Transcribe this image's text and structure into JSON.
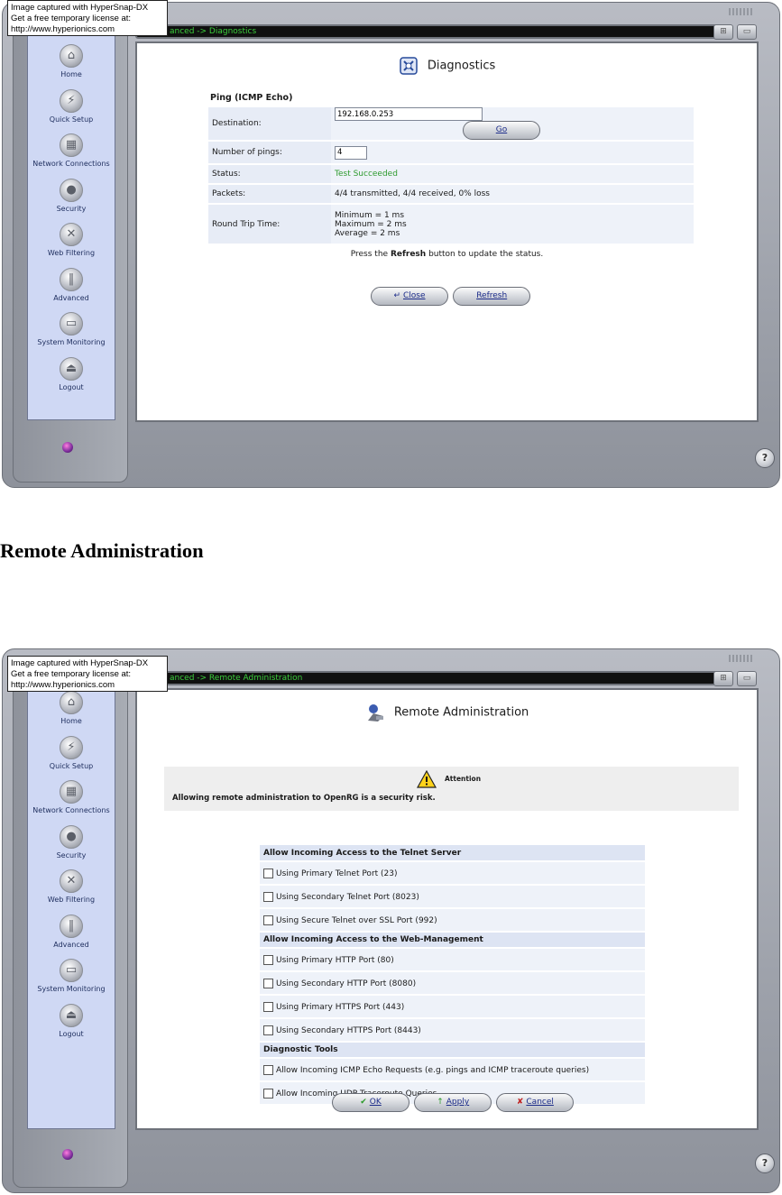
{
  "watermark": {
    "line1": "Image captured with HyperSnap-DX",
    "line2": "Get a free temporary license at:",
    "line3": "http://www.hyperionics.com"
  },
  "sidebar": {
    "items": [
      {
        "label": "Home",
        "icon": "home-icon"
      },
      {
        "label": "Quick Setup",
        "icon": "lightning-icon"
      },
      {
        "label": "Network Connections",
        "icon": "network-icon"
      },
      {
        "label": "Security",
        "icon": "lock-icon"
      },
      {
        "label": "Web Filtering",
        "icon": "filter-icon"
      },
      {
        "label": "Advanced",
        "icon": "tools-icon"
      },
      {
        "label": "System Monitoring",
        "icon": "monitor-icon"
      },
      {
        "label": "Logout",
        "icon": "logout-icon"
      }
    ]
  },
  "diagnostics": {
    "breadcrumb": "anced -> Diagnostics",
    "title": "Diagnostics",
    "section": "Ping (ICMP Echo)",
    "destination_label": "Destination:",
    "destination_value": "192.168.0.253",
    "go_label": "Go",
    "pings_label": "Number of pings:",
    "pings_value": "4",
    "status_label": "Status:",
    "status_value": "Test Succeeded",
    "packets_label": "Packets:",
    "packets_value": "4/4 transmitted, 4/4 received, 0% loss",
    "rtt_label": "Round Trip Time:",
    "rtt_min": "Minimum = 1 ms",
    "rtt_max": "Maximum = 2 ms",
    "rtt_avg": "Average = 2 ms",
    "note_pre": "Press the ",
    "note_bold": "Refresh",
    "note_post": " button to update the status.",
    "close_label": "Close",
    "refresh_label": "Refresh"
  },
  "heading": "Remote Administration",
  "remote": {
    "breadcrumb": "anced -> Remote Administration",
    "title": "Remote Administration",
    "attention_label": "Attention",
    "attention_text": "Allowing remote administration to OpenRG is a security risk.",
    "telnet_header": "Allow Incoming Access to the Telnet Server",
    "telnet_opts": [
      "Using Primary Telnet Port (23)",
      "Using Secondary Telnet Port (8023)",
      "Using Secure Telnet over SSL Port (992)"
    ],
    "web_header": "Allow Incoming Access to the Web-Management",
    "web_opts": [
      "Using Primary HTTP Port (80)",
      "Using Secondary HTTP Port (8080)",
      "Using Primary HTTPS Port (443)",
      "Using Secondary HTTPS Port (8443)"
    ],
    "diag_header": "Diagnostic Tools",
    "diag_opts": [
      "Allow Incoming ICMP Echo Requests (e.g. pings and ICMP traceroute queries)",
      "Allow Incoming UDP Traceroute Queries"
    ],
    "ok_label": "OK",
    "apply_label": "Apply",
    "cancel_label": "Cancel"
  }
}
